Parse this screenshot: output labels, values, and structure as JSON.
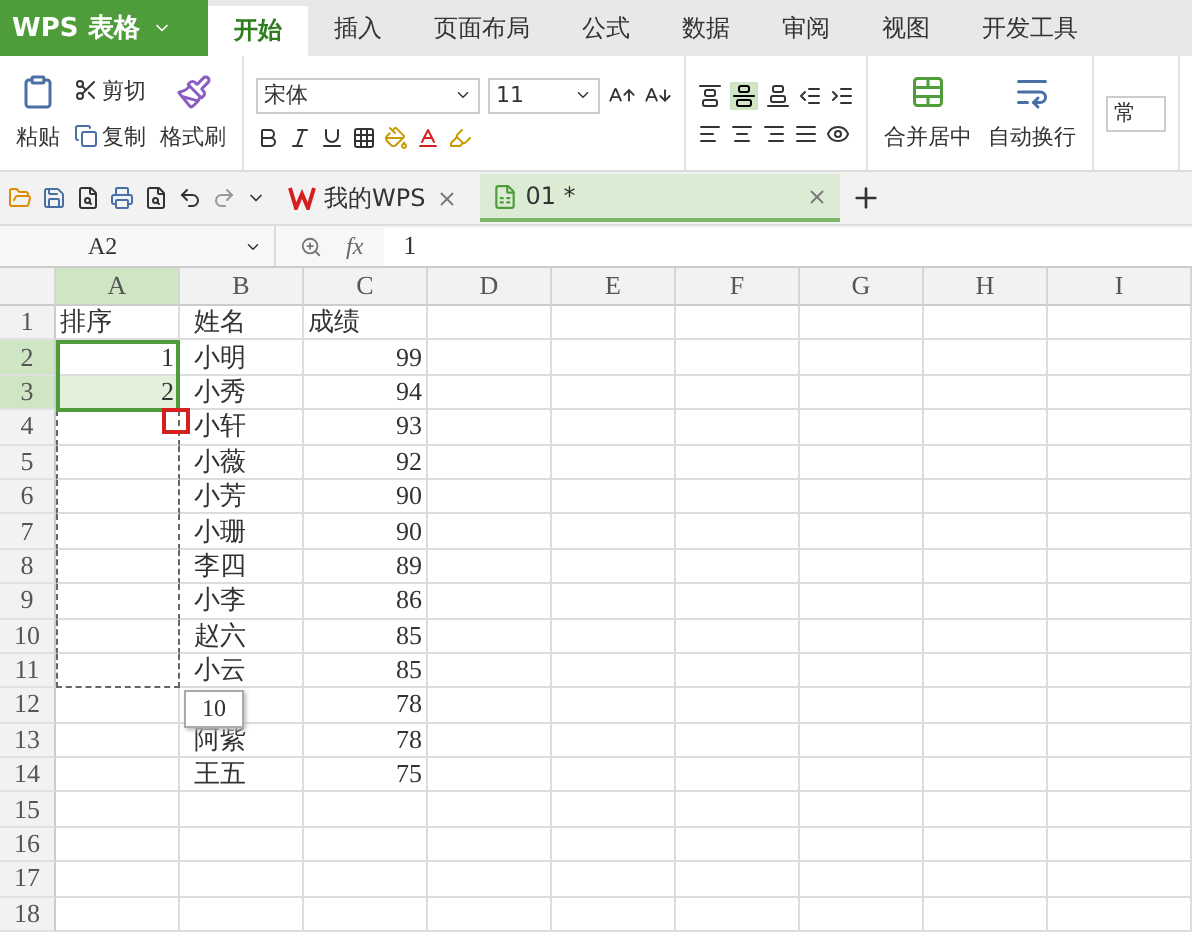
{
  "app_button": {
    "label": "WPS 表格"
  },
  "ribbon_tabs": [
    {
      "label": "开始",
      "selected": true
    },
    {
      "label": "插入",
      "selected": false
    },
    {
      "label": "页面布局",
      "selected": false
    },
    {
      "label": "公式",
      "selected": false
    },
    {
      "label": "数据",
      "selected": false
    },
    {
      "label": "审阅",
      "selected": false
    },
    {
      "label": "视图",
      "selected": false
    },
    {
      "label": "开发工具",
      "selected": false
    }
  ],
  "clipboard": {
    "paste": "粘贴",
    "cut": "剪切",
    "copy": "复制",
    "format_painter": "格式刷"
  },
  "font": {
    "name": "宋体",
    "size": "11"
  },
  "merge": {
    "merge_center": "合并居中",
    "wrap_text": "自动换行",
    "number_format": "常"
  },
  "doc_tabs": [
    {
      "label": "我的WPS",
      "kind": "home",
      "selected": false
    },
    {
      "label": "01 *",
      "kind": "sheet",
      "selected": true
    }
  ],
  "formula_bar": {
    "name_box": "A2",
    "fx": "fx",
    "value": "1"
  },
  "columns": [
    {
      "label": "A",
      "selected": true
    },
    {
      "label": "B",
      "selected": false
    },
    {
      "label": "C",
      "selected": false
    },
    {
      "label": "D",
      "selected": false
    },
    {
      "label": "E",
      "selected": false
    },
    {
      "label": "F",
      "selected": false
    },
    {
      "label": "G",
      "selected": false
    },
    {
      "label": "H",
      "selected": false
    },
    {
      "label": "I",
      "selected": false
    }
  ],
  "rows": [
    {
      "number": "1",
      "selected": false,
      "fill_preview": false,
      "cells": [
        "排序",
        "姓名",
        "成绩"
      ]
    },
    {
      "number": "2",
      "selected": true,
      "fill_preview": false,
      "cells": [
        "1",
        "小明",
        "99"
      ]
    },
    {
      "number": "3",
      "selected": true,
      "fill_preview": false,
      "cells": [
        "2",
        "小秀",
        "94"
      ]
    },
    {
      "number": "4",
      "selected": false,
      "fill_preview": true,
      "cells": [
        "",
        "小轩",
        "93"
      ]
    },
    {
      "number": "5",
      "selected": false,
      "fill_preview": true,
      "cells": [
        "",
        "小薇",
        "92"
      ]
    },
    {
      "number": "6",
      "selected": false,
      "fill_preview": true,
      "cells": [
        "",
        "小芳",
        "90"
      ]
    },
    {
      "number": "7",
      "selected": false,
      "fill_preview": true,
      "cells": [
        "",
        "小珊",
        "90"
      ]
    },
    {
      "number": "8",
      "selected": false,
      "fill_preview": true,
      "cells": [
        "",
        "李四",
        "89"
      ]
    },
    {
      "number": "9",
      "selected": false,
      "fill_preview": true,
      "cells": [
        "",
        "小李",
        "86"
      ]
    },
    {
      "number": "10",
      "selected": false,
      "fill_preview": true,
      "cells": [
        "",
        "赵六",
        "85"
      ]
    },
    {
      "number": "11",
      "selected": false,
      "fill_preview": true,
      "cells": [
        "",
        "小云",
        "85"
      ]
    },
    {
      "number": "12",
      "selected": false,
      "fill_preview": false,
      "cells": [
        "",
        "",
        "78"
      ]
    },
    {
      "number": "13",
      "selected": false,
      "fill_preview": false,
      "cells": [
        "",
        "阿紫",
        "78"
      ]
    },
    {
      "number": "14",
      "selected": false,
      "fill_preview": false,
      "cells": [
        "",
        "王五",
        "75"
      ]
    },
    {
      "number": "15",
      "selected": false,
      "fill_preview": false,
      "cells": [
        "",
        "",
        ""
      ]
    },
    {
      "number": "16",
      "selected": false,
      "fill_preview": false,
      "cells": [
        "",
        "",
        ""
      ]
    },
    {
      "number": "17",
      "selected": false,
      "fill_preview": false,
      "cells": [
        "",
        "",
        ""
      ]
    },
    {
      "number": "18",
      "selected": false,
      "fill_preview": false,
      "cells": [
        "",
        "",
        ""
      ]
    }
  ],
  "fill_tooltip": "10"
}
